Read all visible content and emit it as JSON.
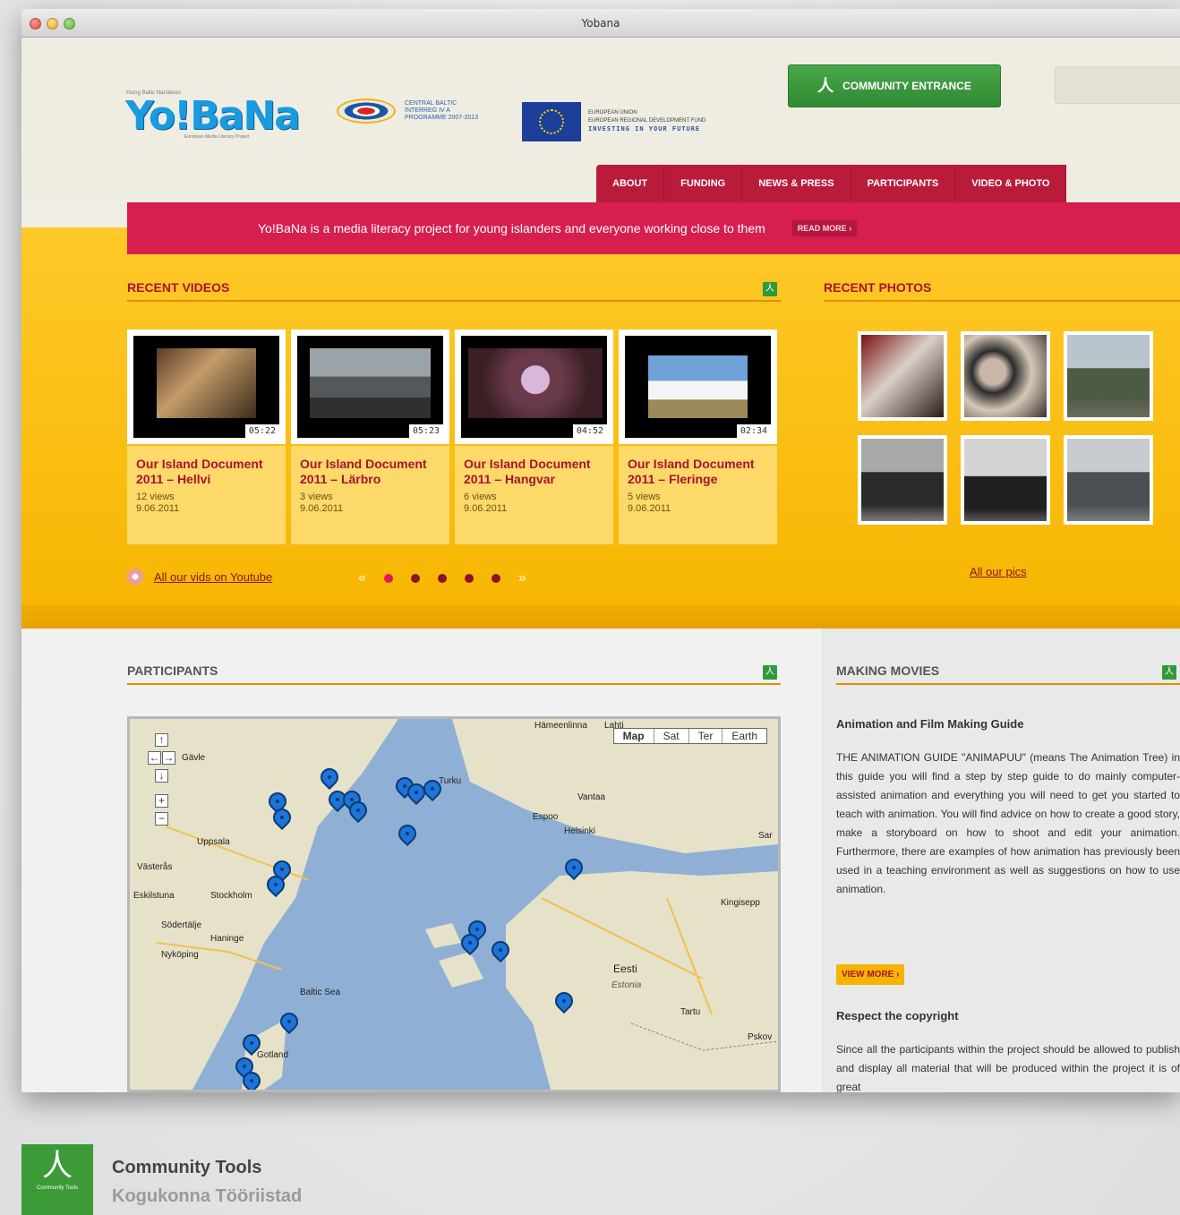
{
  "window": {
    "title": "Yobana"
  },
  "header": {
    "logo_tagline": "Young Baltic Narratives",
    "logo_mark": "Yo!BaNa",
    "logo_sub": "European Media Literacy Project",
    "interreg_text": "CENTRAL BALTIC INTERREG IV A PROGRAMME 2007-2013",
    "eu_line1": "EUROPEAN UNION",
    "eu_line2": "EUROPEAN REGIONAL DEVELOPMENT FUND",
    "eu_line3": "INVESTING IN YOUR FUTURE",
    "community_button": "COMMUNITY ENTRANCE"
  },
  "nav": [
    "ABOUT",
    "FUNDING",
    "NEWS & PRESS",
    "PARTICIPANTS",
    "VIDEO & PHOTO"
  ],
  "banner": {
    "text": "Yo!BaNa is a media literacy project for young islanders and everyone working close to them",
    "read_more": "READ MORE ›"
  },
  "recent_videos": {
    "heading": "RECENT VIDEOS",
    "items": [
      {
        "title": "Our Island Document 2011 – Hellvi",
        "views": "12 views",
        "date": "9.06.2011",
        "duration": "05:22"
      },
      {
        "title": "Our Island Document 2011 – Lärbro",
        "views": "3 views",
        "date": "9.06.2011",
        "duration": "05:23"
      },
      {
        "title": "Our Island Document 2011 – Hangvar",
        "views": "6 views",
        "date": "9.06.2011",
        "duration": "04:52"
      },
      {
        "title": "Our Island Document 2011 – Fleringe",
        "views": "5 views",
        "date": "9.06.2011",
        "duration": "02:34"
      }
    ],
    "youtube_link": "All our vids on Youtube",
    "pager_prev": "«",
    "pager_next": "»"
  },
  "recent_photos": {
    "heading": "RECENT PHOTOS",
    "link": "All our pics"
  },
  "participants": {
    "heading": "PARTICIPANTS",
    "map_types": [
      "Map",
      "Sat",
      "Ter",
      "Earth"
    ],
    "map_labels": [
      "Hämeenlinna",
      "Lahti",
      "Turku",
      "Vantaa",
      "Espoo",
      "Helsinki",
      "Uppsala",
      "Västerås",
      "Eskilstuna",
      "Stockholm",
      "Södertälje",
      "Haninge",
      "Nyköping",
      "Baltic Sea",
      "Eesti",
      "Estonia",
      "Tartu",
      "Pskov",
      "Kingisepp",
      "Gotland",
      "Gävle",
      "Sar"
    ]
  },
  "making_movies": {
    "heading": "MAKING MOVIES",
    "guide_title": "Animation and Film Making Guide",
    "guide_text": "THE ANIMATION GUIDE \"ANIMAPUU\" (means The Animation Tree) in this guide you will find a step by step guide to do mainly computer-assisted animation and everything you will need to get you started to teach with animation. You will find advice on how to create a good story, make a storyboard on how to shoot and edit your animation. Furthermore, there are examples of how animation has previously been used in a teaching environment as well as suggestions on how to use animation.",
    "view_more": "VIEW MORE ›",
    "copyright_title": "Respect the copyright",
    "copyright_text": "Since all the participants within the project should be allowed to publish and display all material that will be produced within the project it is of great"
  },
  "brand": {
    "title": "Community Tools",
    "subtitle": "Kogukonna Tööriistad",
    "icon_label": "Community Tools"
  },
  "colors": {
    "green": "#2f9a3c",
    "crimson": "#d61f4f",
    "yellow": "#ffc929",
    "maroon": "#a8132e"
  }
}
